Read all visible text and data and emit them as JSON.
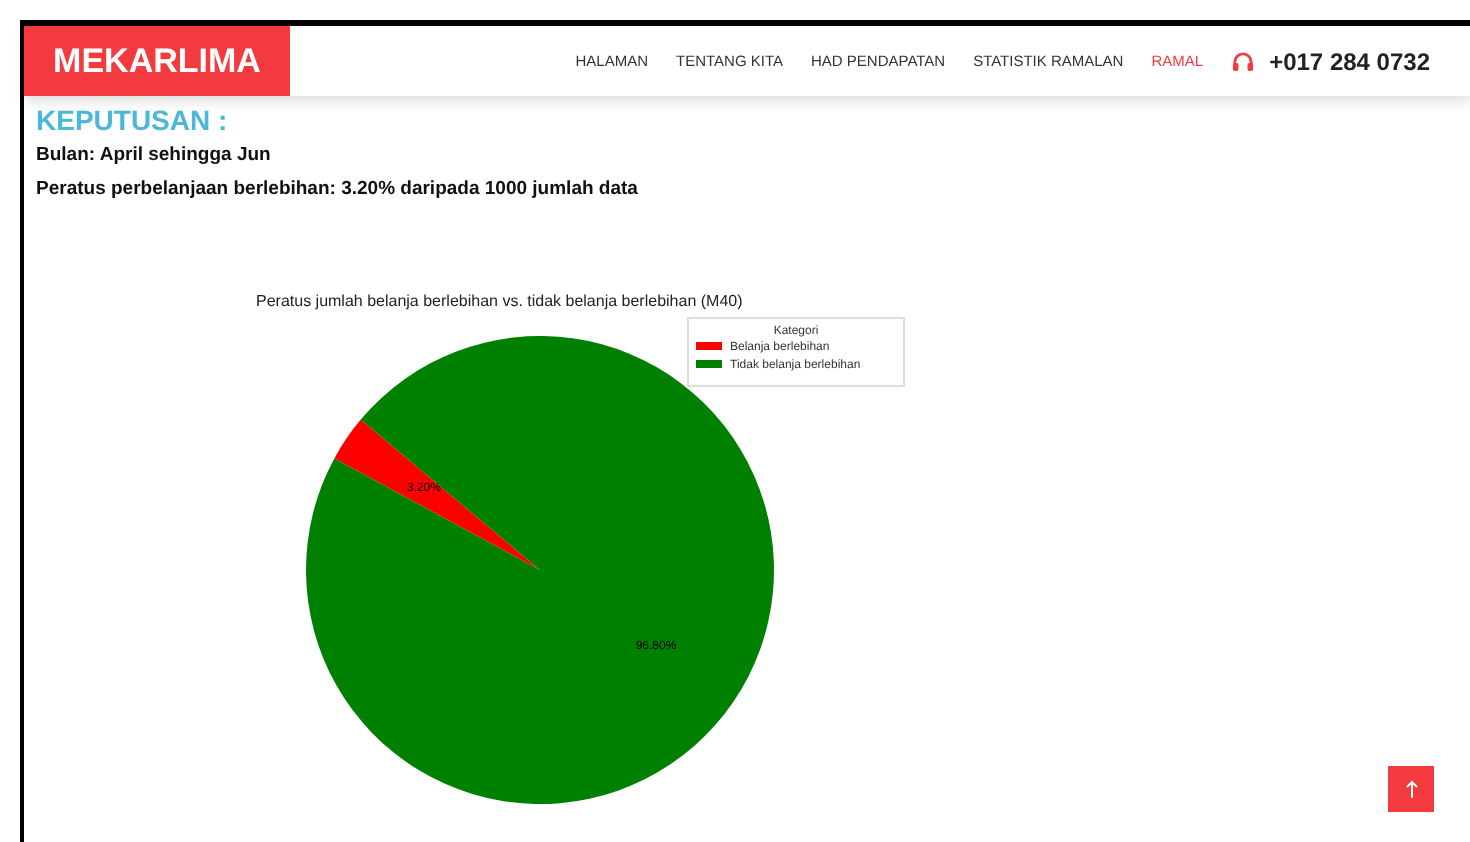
{
  "header": {
    "logo": "MEKARLIMA",
    "nav": [
      {
        "label": "HALAMAN",
        "selected": false
      },
      {
        "label": "TENTANG KITA",
        "selected": false
      },
      {
        "label": "HAD PENDAPATAN",
        "selected": false
      },
      {
        "label": "STATISTIK RAMALAN",
        "selected": false
      },
      {
        "label": "RAMAL",
        "selected": true
      }
    ],
    "phone": "+017 284 0732"
  },
  "result": {
    "heading": "KEPUTUSAN :",
    "period": "Bulan: April sehingga Jun",
    "summary": "Peratus perbelanjaan berlebihan: 3.20% daripada 1000 jumlah data",
    "chart_data": {
      "type": "pie",
      "title": "Peratus jumlah belanja berlebihan vs. tidak belanja berlebihan (M40)",
      "legend": {
        "title": "Kategori"
      },
      "categories": [
        "Belanja berlebihan",
        "Tidak belanja berlebihan"
      ],
      "values": [
        3.2,
        96.8
      ],
      "colors": [
        "#ff0000",
        "#008000"
      ],
      "value_labels": [
        "3.20%",
        "96.80%"
      ]
    }
  }
}
